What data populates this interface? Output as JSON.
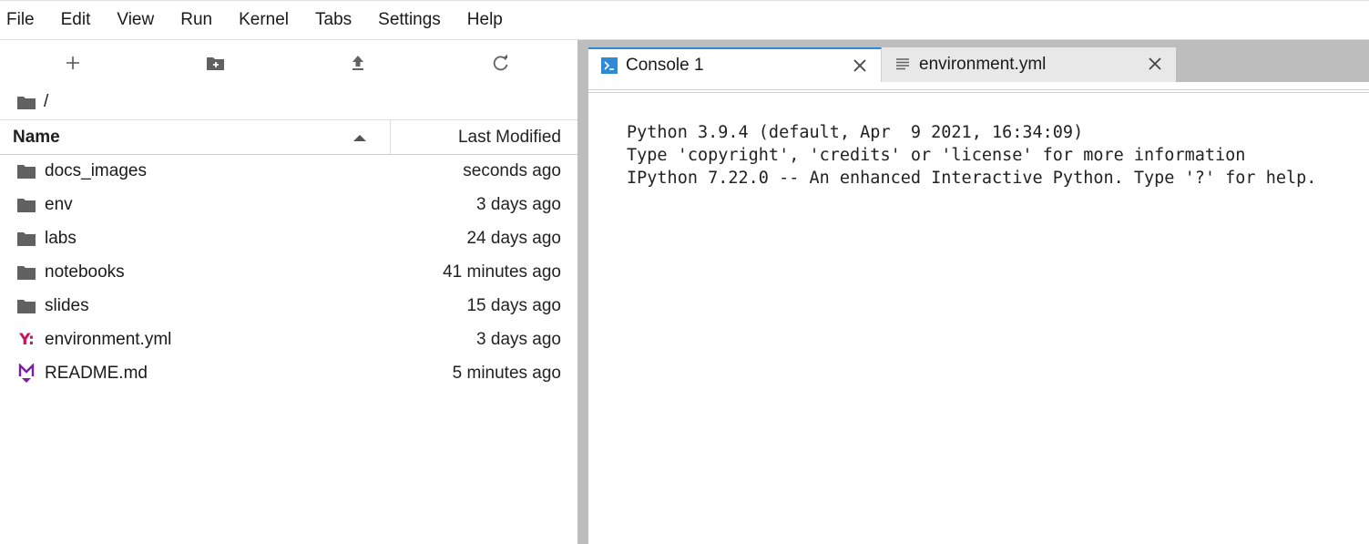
{
  "menu": {
    "items": [
      "File",
      "Edit",
      "View",
      "Run",
      "Kernel",
      "Tabs",
      "Settings",
      "Help"
    ]
  },
  "file_browser": {
    "toolbar": {
      "new_launcher_icon": "plus-icon",
      "new_folder_icon": "new-folder-icon",
      "upload_icon": "upload-icon",
      "refresh_icon": "refresh-icon"
    },
    "breadcrumb": {
      "icon": "folder-icon",
      "label": "/"
    },
    "columns": {
      "name": "Name",
      "last_modified": "Last Modified",
      "sort": "ascending"
    },
    "files": [
      {
        "name": "docs_images",
        "modified": "seconds ago",
        "type": "folder"
      },
      {
        "name": "env",
        "modified": "3 days ago",
        "type": "folder"
      },
      {
        "name": "labs",
        "modified": "24 days ago",
        "type": "folder"
      },
      {
        "name": "notebooks",
        "modified": "41 minutes ago",
        "type": "folder"
      },
      {
        "name": "slides",
        "modified": "15 days ago",
        "type": "folder"
      },
      {
        "name": "environment.yml",
        "modified": "3 days ago",
        "type": "yaml"
      },
      {
        "name": "README.md",
        "modified": "5 minutes ago",
        "type": "markdown"
      }
    ]
  },
  "tabs": [
    {
      "label": "Console 1",
      "icon": "console-icon",
      "active": true
    },
    {
      "label": "environment.yml",
      "icon": "text-file-icon",
      "active": false
    }
  ],
  "console": {
    "banner": [
      "Python 3.9.4 (default, Apr  9 2021, 16:34:09)",
      "Type 'copyright', 'credits' or 'license' for more information",
      "IPython 7.22.0 -- An enhanced Interactive Python. Type '?' for help."
    ]
  },
  "colors": {
    "accent": "#2e8ad8",
    "folder": "#616161",
    "yaml": "#c4165f",
    "markdown": "#7b1fa2",
    "splitter": "#bdbdbd"
  }
}
